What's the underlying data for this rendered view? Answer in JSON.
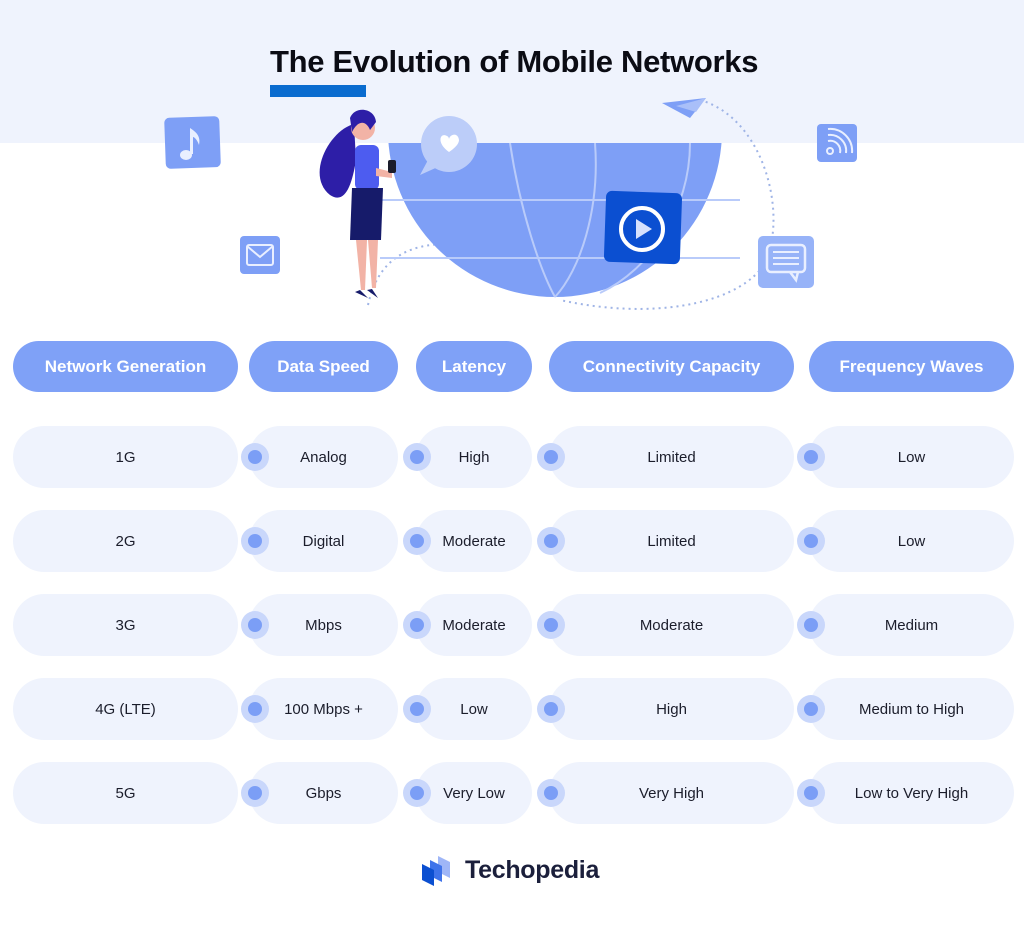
{
  "header": {
    "title": "The Evolution of Mobile Networks"
  },
  "colors": {
    "accent": "#0a6ccf",
    "header_pill": "#7fa1f7",
    "cell_bg": "#eff3fd",
    "top_band": "#eff3fd",
    "dot": "#7b9ef6",
    "illustration_blue": "#7e9ff6",
    "illustration_dark_blue": "#0b4fd1"
  },
  "illustration": {
    "icons": [
      "music-note-icon",
      "mail-icon",
      "heart-chat-bubble-icon",
      "globe-icon",
      "play-video-icon",
      "paper-plane-icon",
      "rss-feed-icon",
      "message-icon",
      "woman-with-phone-figure"
    ]
  },
  "table": {
    "columns": [
      "Network Generation",
      "Data Speed",
      "Latency",
      "Connectivity Capacity",
      "Frequency Waves"
    ],
    "rows": [
      [
        "1G",
        "Analog",
        "High",
        "Limited",
        "Low"
      ],
      [
        "2G",
        "Digital",
        "Moderate",
        "Limited",
        "Low"
      ],
      [
        "3G",
        "Mbps",
        "Moderate",
        "Moderate",
        "Medium"
      ],
      [
        "4G (LTE)",
        "100 Mbps +",
        "Low",
        "High",
        "Medium to High"
      ],
      [
        "5G",
        "Gbps",
        "Very Low",
        "Very High",
        "Low to Very High"
      ]
    ]
  },
  "footer": {
    "brand": "Techopedia",
    "logo_icon": "techopedia-logo-icon"
  }
}
